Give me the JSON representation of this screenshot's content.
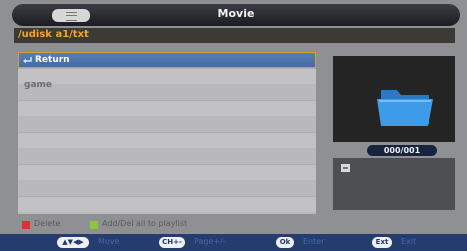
{
  "header": {
    "title": "Movie",
    "menu_icon": "list-icon"
  },
  "path": "/udisk a1/txt",
  "files": [
    {
      "label": "Return",
      "icon": "return-arrow-icon",
      "selected": true
    },
    {
      "label": "game",
      "icon": "",
      "selected": false
    }
  ],
  "preview": {
    "icon": "folder-icon",
    "counter": "000/001"
  },
  "legend": {
    "red_label": "Delete",
    "green_label": "Add/Del all to playlist",
    "colors": {
      "red": "#e03030",
      "green": "#8cc63f"
    }
  },
  "hints": [
    {
      "key": "▲▼◀▶",
      "action": "Move"
    },
    {
      "key": "CH+-",
      "action": "Page+/-"
    },
    {
      "key": "Ok",
      "action": "Enter"
    },
    {
      "key": "Ext",
      "action": "Exit"
    }
  ],
  "colors": {
    "path_text": "#f4a42a",
    "selected_row": "#4f75ad",
    "hint_bar": "#243d6e"
  }
}
